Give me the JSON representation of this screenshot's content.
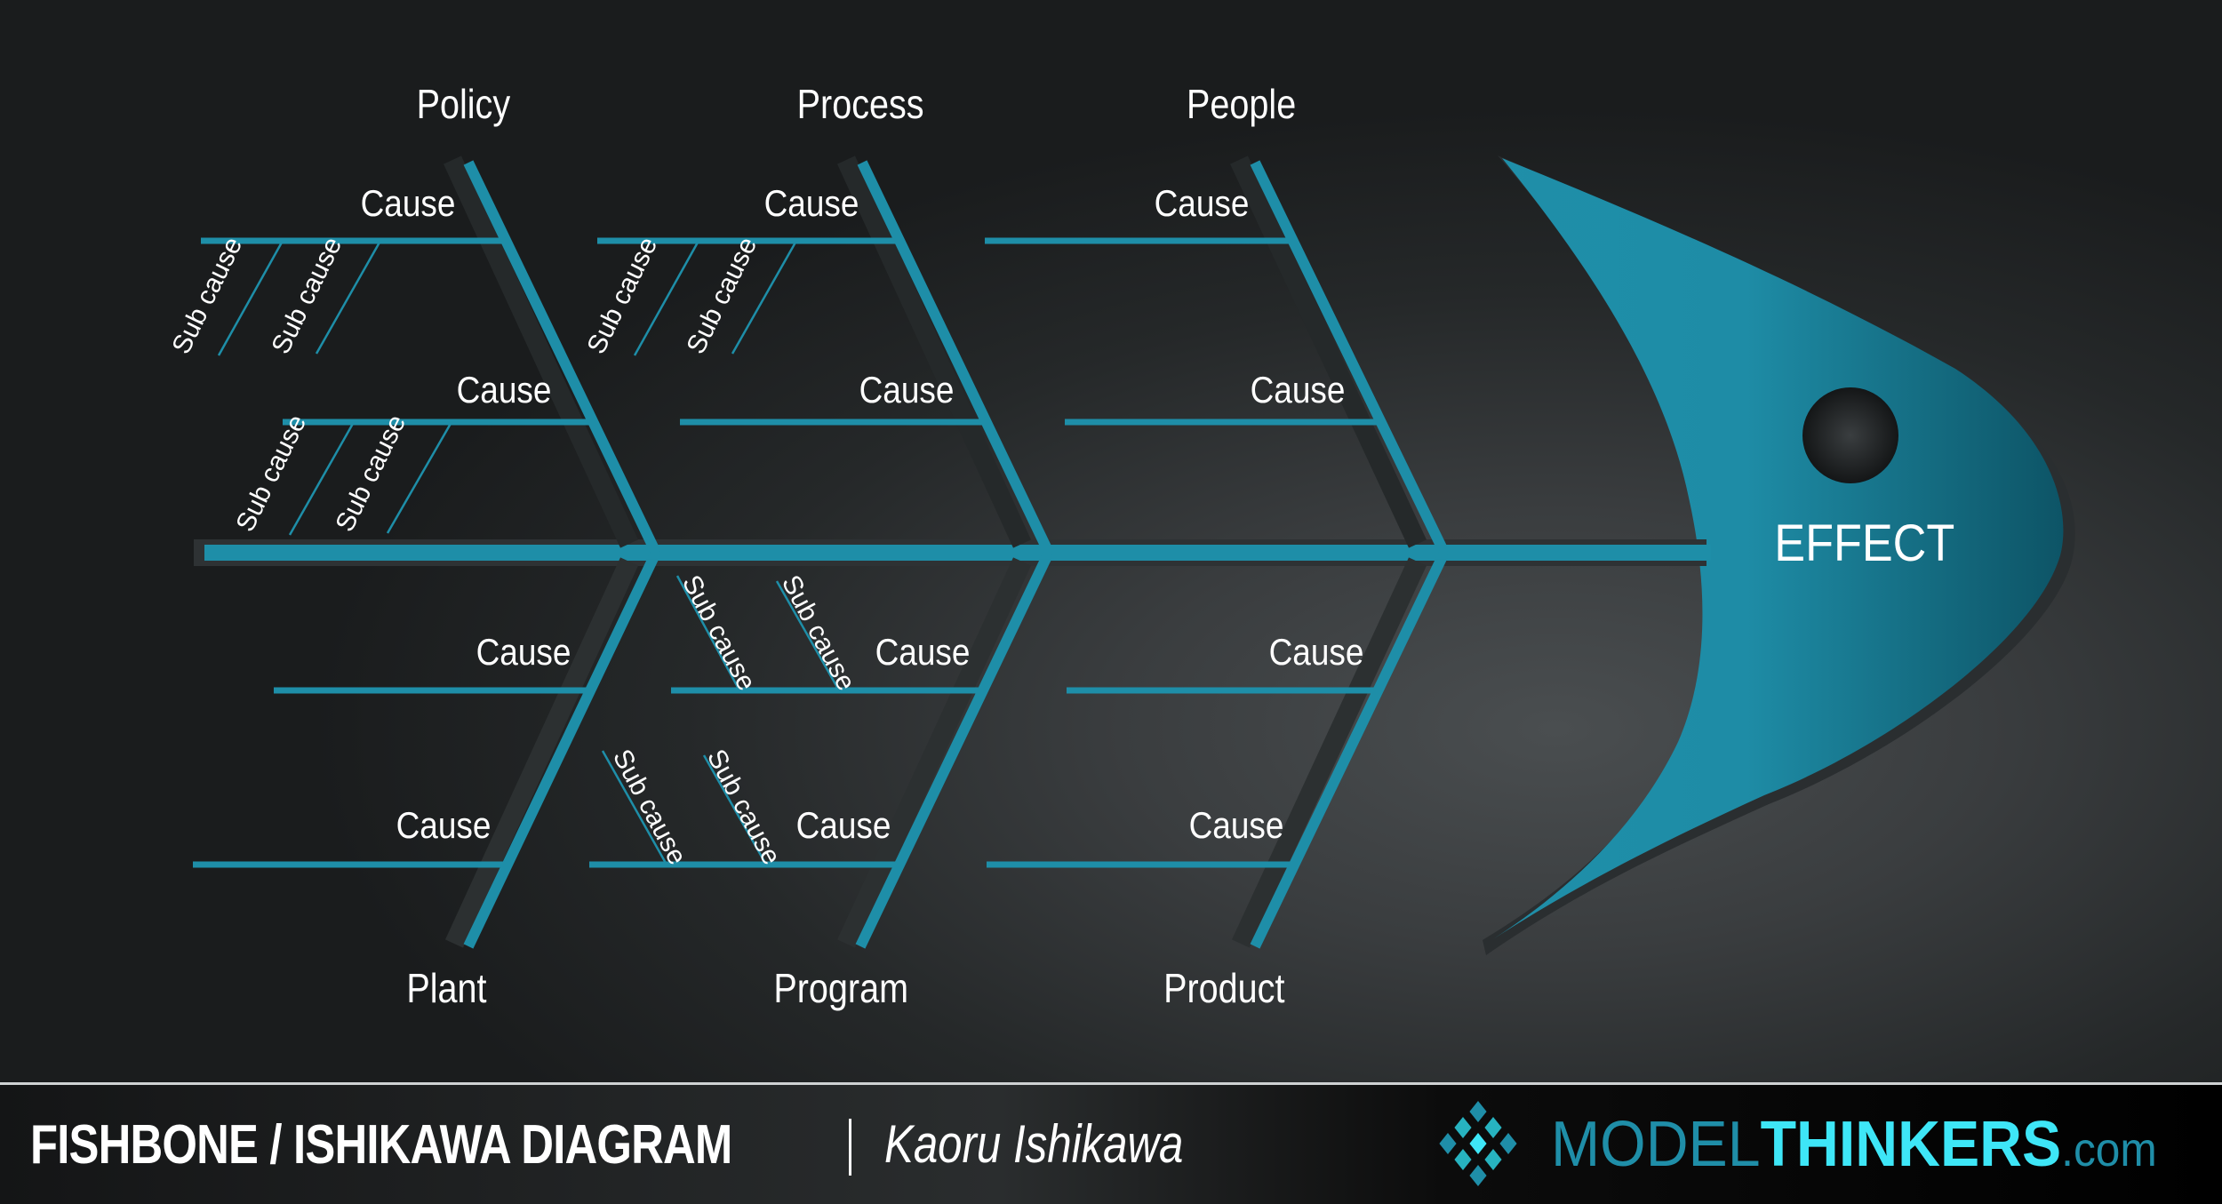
{
  "diagram": {
    "title": "Fishbone / Ishikawa Diagram",
    "effect": "EFFECT",
    "colors": {
      "bone": "#1e8ea8",
      "head_light": "#1f8fa9",
      "head_dark": "#0e5a6c",
      "text": "#ffffff",
      "background_dark": "#1a1c1d",
      "background_light": "#4a4e50"
    },
    "categories_top": [
      {
        "label": "Policy",
        "causes": [
          {
            "label": "Cause",
            "sub_causes": [
              "Sub cause",
              "Sub cause"
            ]
          },
          {
            "label": "Cause",
            "sub_causes": [
              "Sub cause",
              "Sub cause"
            ]
          }
        ]
      },
      {
        "label": "Process",
        "causes": [
          {
            "label": "Cause",
            "sub_causes": [
              "Sub cause",
              "Sub cause"
            ]
          },
          {
            "label": "Cause",
            "sub_causes": []
          }
        ]
      },
      {
        "label": "People",
        "causes": [
          {
            "label": "Cause",
            "sub_causes": []
          },
          {
            "label": "Cause",
            "sub_causes": []
          }
        ]
      }
    ],
    "categories_bottom": [
      {
        "label": "Plant",
        "causes": [
          {
            "label": "Cause",
            "sub_causes": []
          },
          {
            "label": "Cause",
            "sub_causes": []
          }
        ]
      },
      {
        "label": "Program",
        "causes": [
          {
            "label": "Cause",
            "sub_causes": [
              "Sub cause",
              "Sub cause"
            ]
          },
          {
            "label": "Cause",
            "sub_causes": [
              "Sub cause",
              "Sub cause"
            ]
          }
        ]
      },
      {
        "label": "Product",
        "causes": [
          {
            "label": "Cause",
            "sub_causes": []
          },
          {
            "label": "Cause",
            "sub_causes": []
          }
        ]
      }
    ]
  },
  "footer": {
    "title": "FISHBONE / ISHIKAWA DIAGRAM",
    "separator": "|",
    "author": "Kaoru Ishikawa",
    "brand_part1": "MODEL",
    "brand_part2": "THINKERS",
    "brand_part3": ".com",
    "logo_icon": "diamond-grid-icon",
    "logo_colors": [
      "#1f8ea8",
      "#27b3c0",
      "#3ee6f7"
    ]
  }
}
